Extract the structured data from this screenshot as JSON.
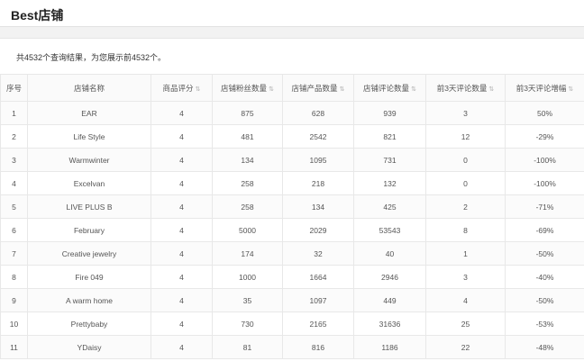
{
  "header": {
    "title": "Best店铺"
  },
  "summary": "共4532个查询结果，为您展示前4532个。",
  "icons": {
    "sort": "sort-icon"
  },
  "table": {
    "columns": [
      {
        "label": "序号",
        "sortable": false
      },
      {
        "label": "店铺名称",
        "sortable": false
      },
      {
        "label": "商品评分",
        "sortable": true
      },
      {
        "label": "店铺粉丝数量",
        "sortable": true
      },
      {
        "label": "店铺产品数量",
        "sortable": true
      },
      {
        "label": "店铺评论数量",
        "sortable": true
      },
      {
        "label": "前3天评论数量",
        "sortable": true
      },
      {
        "label": "前3天评论增幅",
        "sortable": true
      }
    ],
    "rows": [
      [
        "1",
        "EAR",
        "4",
        "875",
        "628",
        "939",
        "3",
        "50%"
      ],
      [
        "2",
        "Life Style",
        "4",
        "481",
        "2542",
        "821",
        "12",
        "-29%"
      ],
      [
        "3",
        "Warmwinter",
        "4",
        "134",
        "1095",
        "731",
        "0",
        "-100%"
      ],
      [
        "4",
        "Excelvan",
        "4",
        "258",
        "218",
        "132",
        "0",
        "-100%"
      ],
      [
        "5",
        "LIVE PLUS B",
        "4",
        "258",
        "134",
        "425",
        "2",
        "-71%"
      ],
      [
        "6",
        "February",
        "4",
        "5000",
        "2029",
        "53543",
        "8",
        "-69%"
      ],
      [
        "7",
        "Creative jewelry",
        "4",
        "174",
        "32",
        "40",
        "1",
        "-50%"
      ],
      [
        "8",
        "Fire 049",
        "4",
        "1000",
        "1664",
        "2946",
        "3",
        "-40%"
      ],
      [
        "9",
        "A warm home",
        "4",
        "35",
        "1097",
        "449",
        "4",
        "-50%"
      ],
      [
        "10",
        "Prettybaby",
        "4",
        "730",
        "2165",
        "31636",
        "25",
        "-53%"
      ],
      [
        "11",
        "YDaisy",
        "4",
        "81",
        "816",
        "1186",
        "22",
        "-48%"
      ]
    ]
  }
}
